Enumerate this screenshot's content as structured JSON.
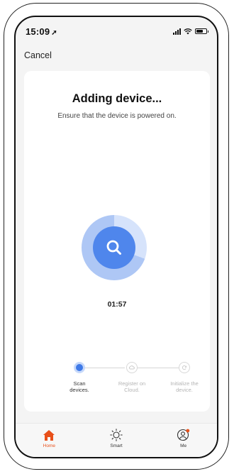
{
  "status_bar": {
    "time": "15:09",
    "location_arrow": "➚"
  },
  "header": {
    "cancel_label": "Cancel"
  },
  "card": {
    "title": "Adding device...",
    "subtitle": "Ensure that the device is powered on.",
    "timer": "01:57",
    "scan_progress_fraction": 0.3
  },
  "steps": [
    {
      "label_line1": "Scan",
      "label_line2": "devices.",
      "state": "active"
    },
    {
      "label_line1": "Register on",
      "label_line2": "Cloud.",
      "state": "pending"
    },
    {
      "label_line1": "Initialize the",
      "label_line2": "device.",
      "state": "pending"
    }
  ],
  "tab_bar": {
    "tabs": [
      {
        "label": "Home",
        "icon": "home-icon",
        "active": true
      },
      {
        "label": "Smart",
        "icon": "sun-icon",
        "active": false
      },
      {
        "label": "Me",
        "icon": "profile-icon",
        "active": false
      }
    ]
  },
  "colors": {
    "accent": "#4f86ec",
    "active_tab": "#e8501a",
    "notification_dot": "#e8501a"
  }
}
